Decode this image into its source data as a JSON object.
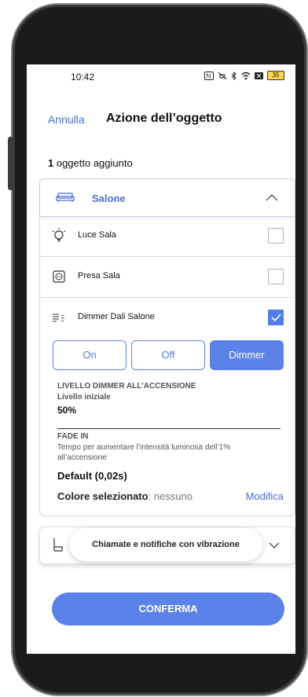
{
  "status_bar": {
    "time": "10:42",
    "battery_level": "35"
  },
  "header": {
    "cancel_label": "Annulla",
    "title": "Azione dell’oggetto"
  },
  "summary": {
    "count": "1",
    "count_text": " oggetto aggiunto"
  },
  "room": {
    "name": "Salone",
    "items": [
      {
        "label": "Luce Sala",
        "icon": "bulb-icon",
        "checked": false
      },
      {
        "label": "Presa Sala",
        "icon": "socket-icon",
        "checked": false
      },
      {
        "label": "Dimmer Dali Salone",
        "icon": "dimmer-icon",
        "checked": true
      }
    ]
  },
  "dimmer": {
    "modes": [
      "On",
      "Off",
      "Dimmer"
    ],
    "active_mode": "Dimmer",
    "level_title": "LIVELLO DIMMER ALL'ACCENSIONE",
    "level_sublabel": "Livello iniziale",
    "level_value": "50%",
    "fade_title": "FADE IN",
    "fade_description": "Tempo per aumentare l’intensità luminosa dell’1% all’accensione",
    "fade_value": "Default (0,02s)",
    "color_label": "Colore selezionato",
    "color_value": ": nessuno",
    "modify_label": "Modifica"
  },
  "toast": {
    "text": "Chiamate e notifiche con vibrazione"
  },
  "footer": {
    "confirm_label": "CONFERMA"
  },
  "colors": {
    "accent": "#5b82e8",
    "link": "#4a6fd6"
  }
}
